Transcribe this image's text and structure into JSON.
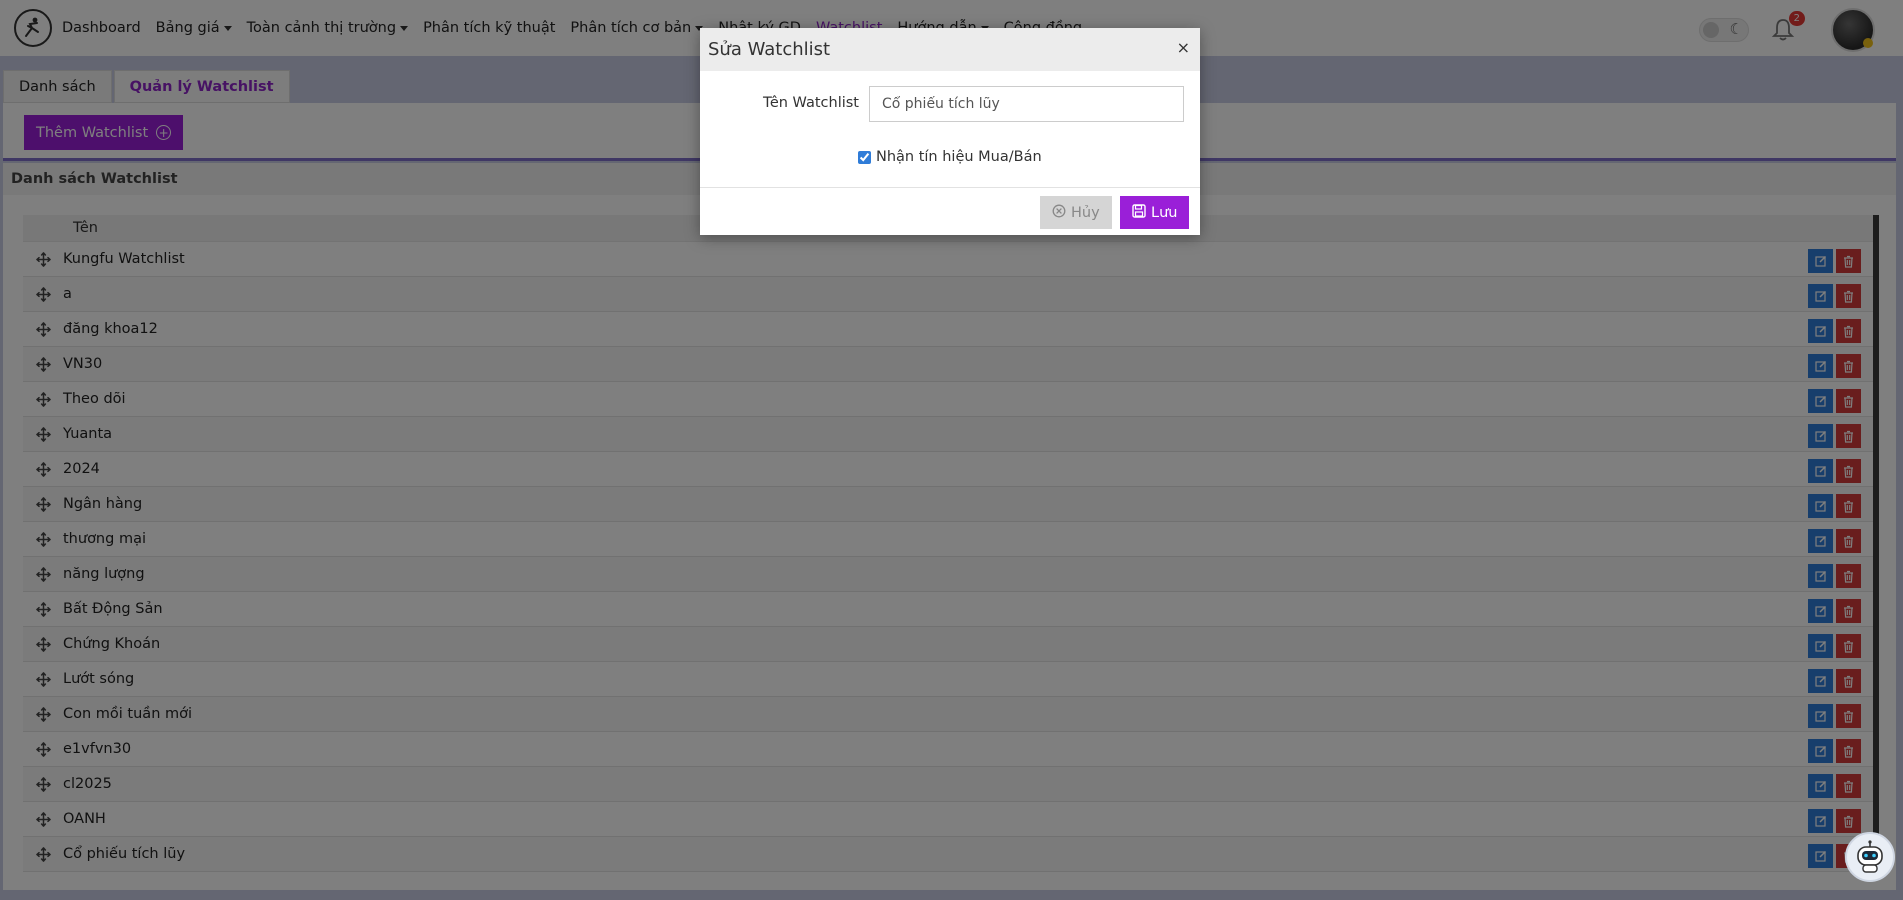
{
  "nav": {
    "items": [
      {
        "label": "Dashboard",
        "dropdown": false
      },
      {
        "label": "Bảng giá",
        "dropdown": true
      },
      {
        "label": "Toàn cảnh thị trường",
        "dropdown": true
      },
      {
        "label": "Phân tích kỹ thuật",
        "dropdown": false
      },
      {
        "label": "Phân tích cơ bản",
        "dropdown": true
      },
      {
        "label": "Nhật ký GD",
        "dropdown": false
      },
      {
        "label": "Watchlist",
        "dropdown": false,
        "active": true
      },
      {
        "label": "Hướng dẫn",
        "dropdown": true
      },
      {
        "label": "Cộng đồng",
        "dropdown": false
      }
    ],
    "notification_count": "2"
  },
  "tabs": [
    {
      "label": "Danh sách"
    },
    {
      "label": "Quản lý Watchlist",
      "active": true
    }
  ],
  "toolbar": {
    "add_label": "Thêm Watchlist"
  },
  "panel": {
    "title": "Danh sách Watchlist",
    "column_name": "Tên",
    "rows": [
      "Kungfu Watchlist",
      "a",
      "đăng khoa12",
      "VN30",
      "Theo dõi",
      "Yuanta",
      "2024",
      "Ngân hàng",
      "thương mại",
      "năng lượng",
      "Bất Động Sản",
      "Chứng Khoán",
      "Lướt sóng",
      "Con mồi tuần mới",
      "e1vfvn30",
      "cl2025",
      "OANH",
      "Cổ phiếu tích lũy"
    ]
  },
  "modal": {
    "title": "Sửa Watchlist",
    "close": "×",
    "name_label": "Tên Watchlist",
    "name_value": "Cổ phiếu tích lũy",
    "signal_label": "Nhận tín hiệu Mua/Bán",
    "signal_checked": true,
    "cancel_label": "Hủy",
    "save_label": "Lưu"
  },
  "colors": {
    "accent": "#9a1fd8",
    "edit": "#2f7cd8",
    "delete": "#d33a3a"
  }
}
